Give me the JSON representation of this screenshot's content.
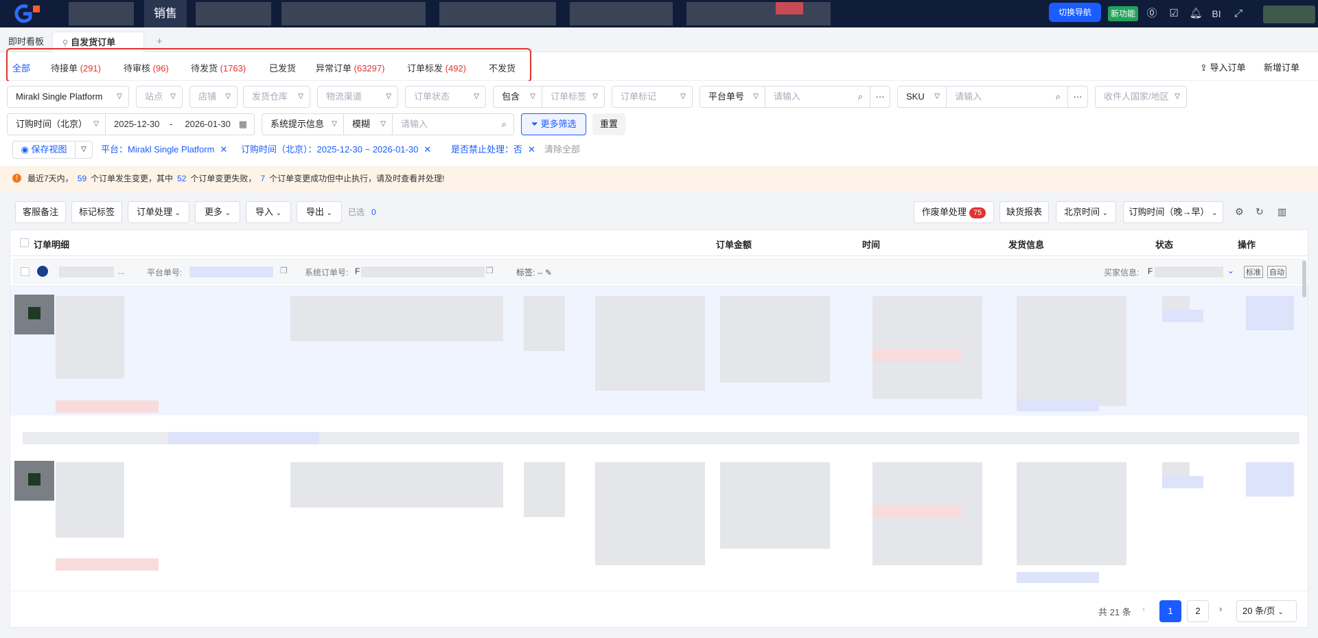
{
  "topbar": {
    "active_nav": "销售",
    "switch_nav": "切换导航",
    "new_feature": "新功能",
    "bi_label": "BI"
  },
  "page_tabs": {
    "dashboard": "即时看板",
    "current": "自发货订单",
    "add": "+"
  },
  "status_tabs": [
    {
      "label": "全部",
      "count": ""
    },
    {
      "label": "待接单",
      "count": "(291)"
    },
    {
      "label": "待审核",
      "count": "(96)"
    },
    {
      "label": "待发货",
      "count": "(1763)"
    },
    {
      "label": "已发货",
      "count": ""
    },
    {
      "label": "异常订单",
      "count": "(63297)"
    },
    {
      "label": "订单标发",
      "count": "(492)"
    },
    {
      "label": "不发货",
      "count": ""
    }
  ],
  "header_actions": {
    "import_order": "导入订单",
    "new_order": "新增订单"
  },
  "filters": {
    "platform": "Mirakl Single Platform",
    "site": "站点",
    "shop": "店铺",
    "warehouse": "发货仓库",
    "logistics": "物流渠道",
    "order_status": "订单状态",
    "contain": "包含",
    "order_tag": "订单标签",
    "order_mark": "订单标记",
    "platform_no": "平台单号",
    "platform_no_placeholder": "请输入",
    "more_dots": "···",
    "sku": "SKU",
    "sku_placeholder": "请输入",
    "country": "收件人国家/地区",
    "time_type": "订购时间（北京）",
    "date_start": "2025-12-30",
    "date_sep": "-",
    "date_end": "2026-01-30",
    "sys_hint": "系统提示信息",
    "fuzzy": "模糊",
    "sys_placeholder": "请输入",
    "more_filter": "更多筛选",
    "reset": "重置"
  },
  "chips": {
    "save_view": "保存视图",
    "chip1": "平台：Mirakl Single Platform",
    "chip2": "订购时间（北京）：2025-12-30 ~ 2026-01-30",
    "chip3": "是否禁止处理：否",
    "clear_all": "清除全部"
  },
  "alert": {
    "t1": "最近7天内，",
    "n1": "59",
    "t2": "个订单发生变更，其中",
    "n2": "52",
    "t3": "个订单变更失败，",
    "n3": "7",
    "t4": "个订单变更成功但中止执行，请及时查看并处理!"
  },
  "toolbar": {
    "cs_note": "客服备注",
    "mark_tag": "标记标签",
    "order_process": "订单处理",
    "more": "更多",
    "import": "导入",
    "export": "导出",
    "selected_label": "已选",
    "selected_count": "0",
    "void_process": "作废单处理",
    "void_count": "75",
    "shortage_report": "缺货报表",
    "timezone": "北京时间",
    "sort": "订购时间（晚→早）"
  },
  "table": {
    "headers": {
      "detail": "订单明细",
      "amount": "订单金额",
      "time": "时间",
      "shipping": "发货信息",
      "status": "状态",
      "action": "操作"
    },
    "order_row": {
      "platform_no_label": "平台单号:",
      "sys_no_label": "系统订单号:",
      "sys_no_prefix": "F",
      "tag_label": "标签:",
      "tag_value": "--",
      "buyer_label": "买家信息:",
      "buyer_prefix": "F",
      "mark_std": "标准",
      "mark_auto": "自动",
      "ellipsis": "..."
    }
  },
  "pagination": {
    "total": "共 21 条",
    "page1": "1",
    "page2": "2",
    "page_size": "20 条/页"
  }
}
